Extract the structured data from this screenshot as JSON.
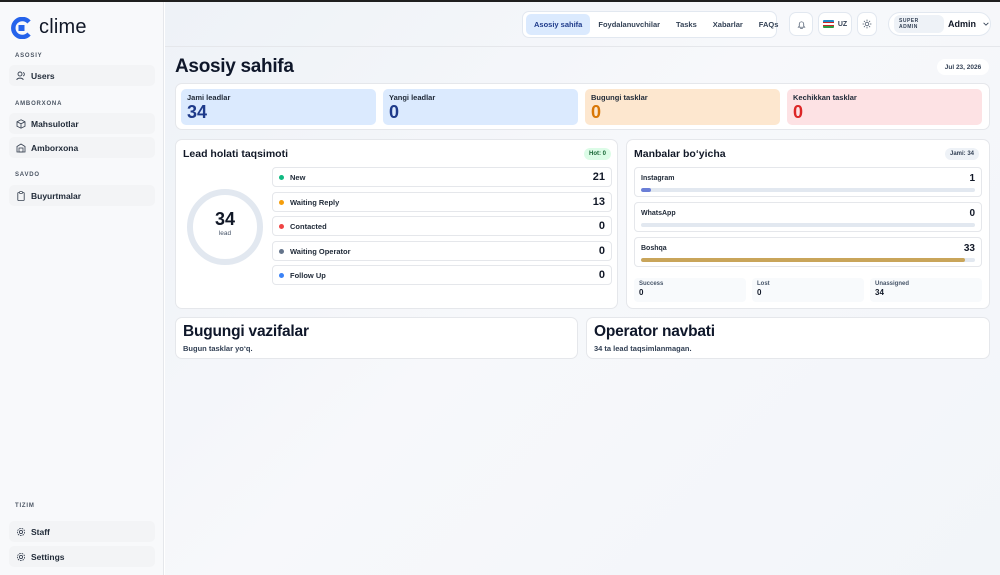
{
  "app": {
    "name": "clime"
  },
  "sidebar": {
    "sections": [
      {
        "label": "ASOSIY",
        "items": [
          {
            "label": "Users",
            "icon": "users-icon"
          }
        ]
      },
      {
        "label": "AMBORXONA",
        "items": [
          {
            "label": "Mahsulotlar",
            "icon": "box-icon"
          },
          {
            "label": "Amborxona",
            "icon": "warehouse-icon"
          }
        ]
      },
      {
        "label": "SAVDO",
        "items": [
          {
            "label": "Buyurtmalar",
            "icon": "clipboard-icon"
          }
        ]
      },
      {
        "label": "TIZIM",
        "items": [
          {
            "label": "Staff",
            "icon": "gear-icon"
          },
          {
            "label": "Settings",
            "icon": "gear-icon"
          }
        ]
      }
    ]
  },
  "header": {
    "tabs": [
      {
        "label": "Asosiy sahifa",
        "active": true
      },
      {
        "label": "Foydalanuvchilar",
        "active": false
      },
      {
        "label": "Tasks",
        "active": false
      },
      {
        "label": "Xabarlar",
        "active": false
      },
      {
        "label": "FAQs",
        "active": false
      }
    ],
    "language": "UZ",
    "user": {
      "role": "SUPER ADMIN",
      "name": "Admin"
    }
  },
  "page": {
    "title": "Asosiy sahifa",
    "date": "Jul 23, 2026"
  },
  "stats": [
    {
      "label": "Jami leadlar",
      "value": "34",
      "bg": "#dbeafe",
      "color": "#1e3a8a"
    },
    {
      "label": "Yangi leadlar",
      "value": "0",
      "bg": "#dbeafe",
      "color": "#1e3a8a"
    },
    {
      "label": "Bugungi tasklar",
      "value": "0",
      "bg": "#fde7cf",
      "color": "#d97706"
    },
    {
      "label": "Kechikkan tasklar",
      "value": "0",
      "bg": "#fde2e4",
      "color": "#dc2626"
    }
  ],
  "lead_status": {
    "title": "Lead holati taqsimoti",
    "badge": "Hot: 0",
    "total": "34",
    "total_label": "lead",
    "items": [
      {
        "label": "New",
        "count": "21",
        "color": "#10b981"
      },
      {
        "label": "Waiting Reply",
        "count": "13",
        "color": "#f59e0b"
      },
      {
        "label": "Contacted",
        "count": "0",
        "color": "#ef4444"
      },
      {
        "label": "Waiting Operator",
        "count": "0",
        "color": "#64748b"
      },
      {
        "label": "Follow Up",
        "count": "0",
        "color": "#3b82f6"
      }
    ]
  },
  "sources": {
    "title": "Manbalar bo‘yicha",
    "badge": "Jami: 34",
    "items": [
      {
        "label": "Instagram",
        "count": "1",
        "fraction": 0.029,
        "color": "#6b7fd7"
      },
      {
        "label": "WhatsApp",
        "count": "0",
        "fraction": 0,
        "color": "#10b981"
      },
      {
        "label": "Boshqa",
        "count": "33",
        "fraction": 0.971,
        "color": "#c9a55a"
      }
    ],
    "outcomes": [
      {
        "label": "Success",
        "value": "0"
      },
      {
        "label": "Lost",
        "value": "0"
      },
      {
        "label": "Unassigned",
        "value": "34"
      }
    ]
  },
  "today_tasks": {
    "title": "Bugungi vazifalar",
    "subtitle": "Bugun tasklar yo‘q."
  },
  "operator_queue": {
    "title": "Operator navbati",
    "subtitle": "34 ta lead taqsimlanmagan."
  }
}
